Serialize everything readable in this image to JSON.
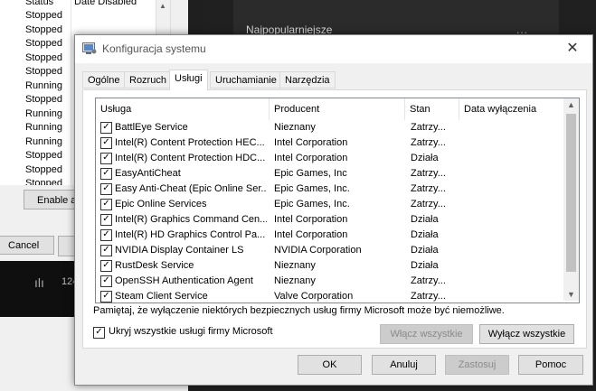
{
  "background": {
    "left_window": {
      "col_status": "Status",
      "col_date": "Date Disabled",
      "statuses": [
        "Stopped",
        "Stopped",
        "Stopped",
        "Stopped",
        "Stopped",
        "Running",
        "Stopped",
        "Running",
        "Running",
        "Running",
        "Stopped",
        "Stopped",
        "Stopped"
      ],
      "enable_button": "Enable al",
      "cancel_button": "Cancel",
      "number": "124"
    },
    "right_panel": {
      "card_title": "Najpopularniejsze",
      "menu_dots": "..."
    }
  },
  "dialog": {
    "title": "Konfiguracja systemu",
    "close_glyph": "✕",
    "tabs": [
      "Ogólne",
      "Rozruch",
      "Usługi",
      "Uruchamianie",
      "Narzędzia"
    ],
    "active_tab": "Usługi",
    "columns": [
      "Usługa",
      "Producent",
      "Stan",
      "Data wyłączenia"
    ],
    "services": [
      {
        "name": "BattlEye Service",
        "vendor": "Nieznany",
        "state": "Zatrzy...",
        "checked": true
      },
      {
        "name": "Intel(R) Content Protection HEC...",
        "vendor": "Intel Corporation",
        "state": "Zatrzy...",
        "checked": true
      },
      {
        "name": "Intel(R) Content Protection HDC...",
        "vendor": "Intel Corporation",
        "state": "Działa",
        "checked": true
      },
      {
        "name": "EasyAntiCheat",
        "vendor": "Epic Games, Inc",
        "state": "Zatrzy...",
        "checked": true
      },
      {
        "name": "Easy Anti-Cheat (Epic Online Ser...",
        "vendor": "Epic Games, Inc.",
        "state": "Zatrzy...",
        "checked": true
      },
      {
        "name": "Epic Online Services",
        "vendor": "Epic Games, Inc.",
        "state": "Zatrzy...",
        "checked": true
      },
      {
        "name": "Intel(R) Graphics Command Cen...",
        "vendor": "Intel Corporation",
        "state": "Działa",
        "checked": true
      },
      {
        "name": "Intel(R) HD Graphics Control Pa...",
        "vendor": "Intel Corporation",
        "state": "Działa",
        "checked": true
      },
      {
        "name": "NVIDIA Display Container LS",
        "vendor": "NVIDIA Corporation",
        "state": "Działa",
        "checked": true
      },
      {
        "name": "RustDesk Service",
        "vendor": "Nieznany",
        "state": "Działa",
        "checked": true
      },
      {
        "name": "OpenSSH Authentication Agent",
        "vendor": "Nieznany",
        "state": "Zatrzy...",
        "checked": true
      },
      {
        "name": "Steam Client Service",
        "vendor": "Valve Corporation",
        "state": "Zatrzy...",
        "checked": true
      }
    ],
    "notice": "Pamiętaj, że wyłączenie niektórych bezpiecznych usług firmy Microsoft może być niemożliwe.",
    "hide_ms_label": "Ukryj wszystkie usługi firmy Microsoft",
    "hide_ms_checked": true,
    "buttons": {
      "enable_all": "Włącz wszystkie",
      "disable_all": "Wyłącz wszystkie",
      "ok": "OK",
      "cancel": "Anuluj",
      "apply": "Zastosuj",
      "help": "Pomoc"
    },
    "check_glyph": "✓"
  }
}
